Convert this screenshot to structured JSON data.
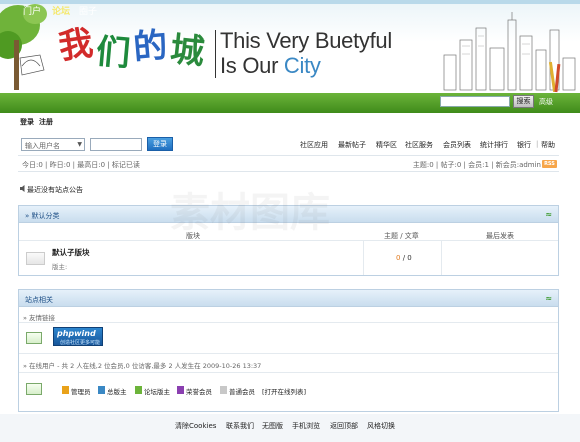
{
  "banner": {
    "logo_text": "我们的城",
    "slogan_line1_a": "This ",
    "slogan_line1_b": "Very",
    "slogan_line1_c": " Buetyful",
    "slogan_line2_a": "Is Our ",
    "slogan_line2_b": "City"
  },
  "nav": {
    "items": [
      "门户",
      "论坛",
      "圈子"
    ],
    "search_button": "搜索",
    "advanced": "高级"
  },
  "auth": {
    "login": "登录",
    "register": "注册"
  },
  "login_form": {
    "user_placeholder": "输入用户名",
    "submit": "登录"
  },
  "menu": [
    "社区应用",
    "最新帖子",
    "精华区",
    "社区服务",
    "会员列表",
    "统计排行",
    "银行",
    "帮助"
  ],
  "stats": {
    "left": "今日:0 | 昨日:0 | 最高日:0 | 标记已读",
    "right": "主题:0 | 帖子:0 | 会员:1 | 新会员:admin",
    "rss": "RSS"
  },
  "announcement": "最近没有站点公告",
  "category": {
    "title": "» 默认分类",
    "columns": {
      "forum": "版块",
      "topics": "主题 / 文章",
      "last": "最后发表"
    },
    "forum": {
      "name": "默认子版块",
      "moderator": "版主:",
      "topics": "0",
      "posts": "0"
    }
  },
  "site": {
    "title": "站点相关",
    "links_label": "» 友情链接",
    "partner": {
      "name": "phpwind",
      "tagline": "创造社区更多可能"
    },
    "online": "» 在线用户 - 共 2 人在线,2 位会员,0 位访客,最多 2 人发生在 2009-10-26 13:37",
    "legend": [
      "管理员",
      "总版主",
      "论坛版主",
      "荣誉会员",
      "普通会员",
      "[打开在线列表]"
    ]
  },
  "footer": [
    "清除Cookies",
    "联系我们",
    "无图版",
    "手机浏览",
    "返回顶部",
    "风格切换"
  ],
  "watermark": "素材图库",
  "colors": {
    "nav_green": "#4f9a22",
    "section_blue": "#c9ddee",
    "link_orange": "#e27a1e"
  }
}
